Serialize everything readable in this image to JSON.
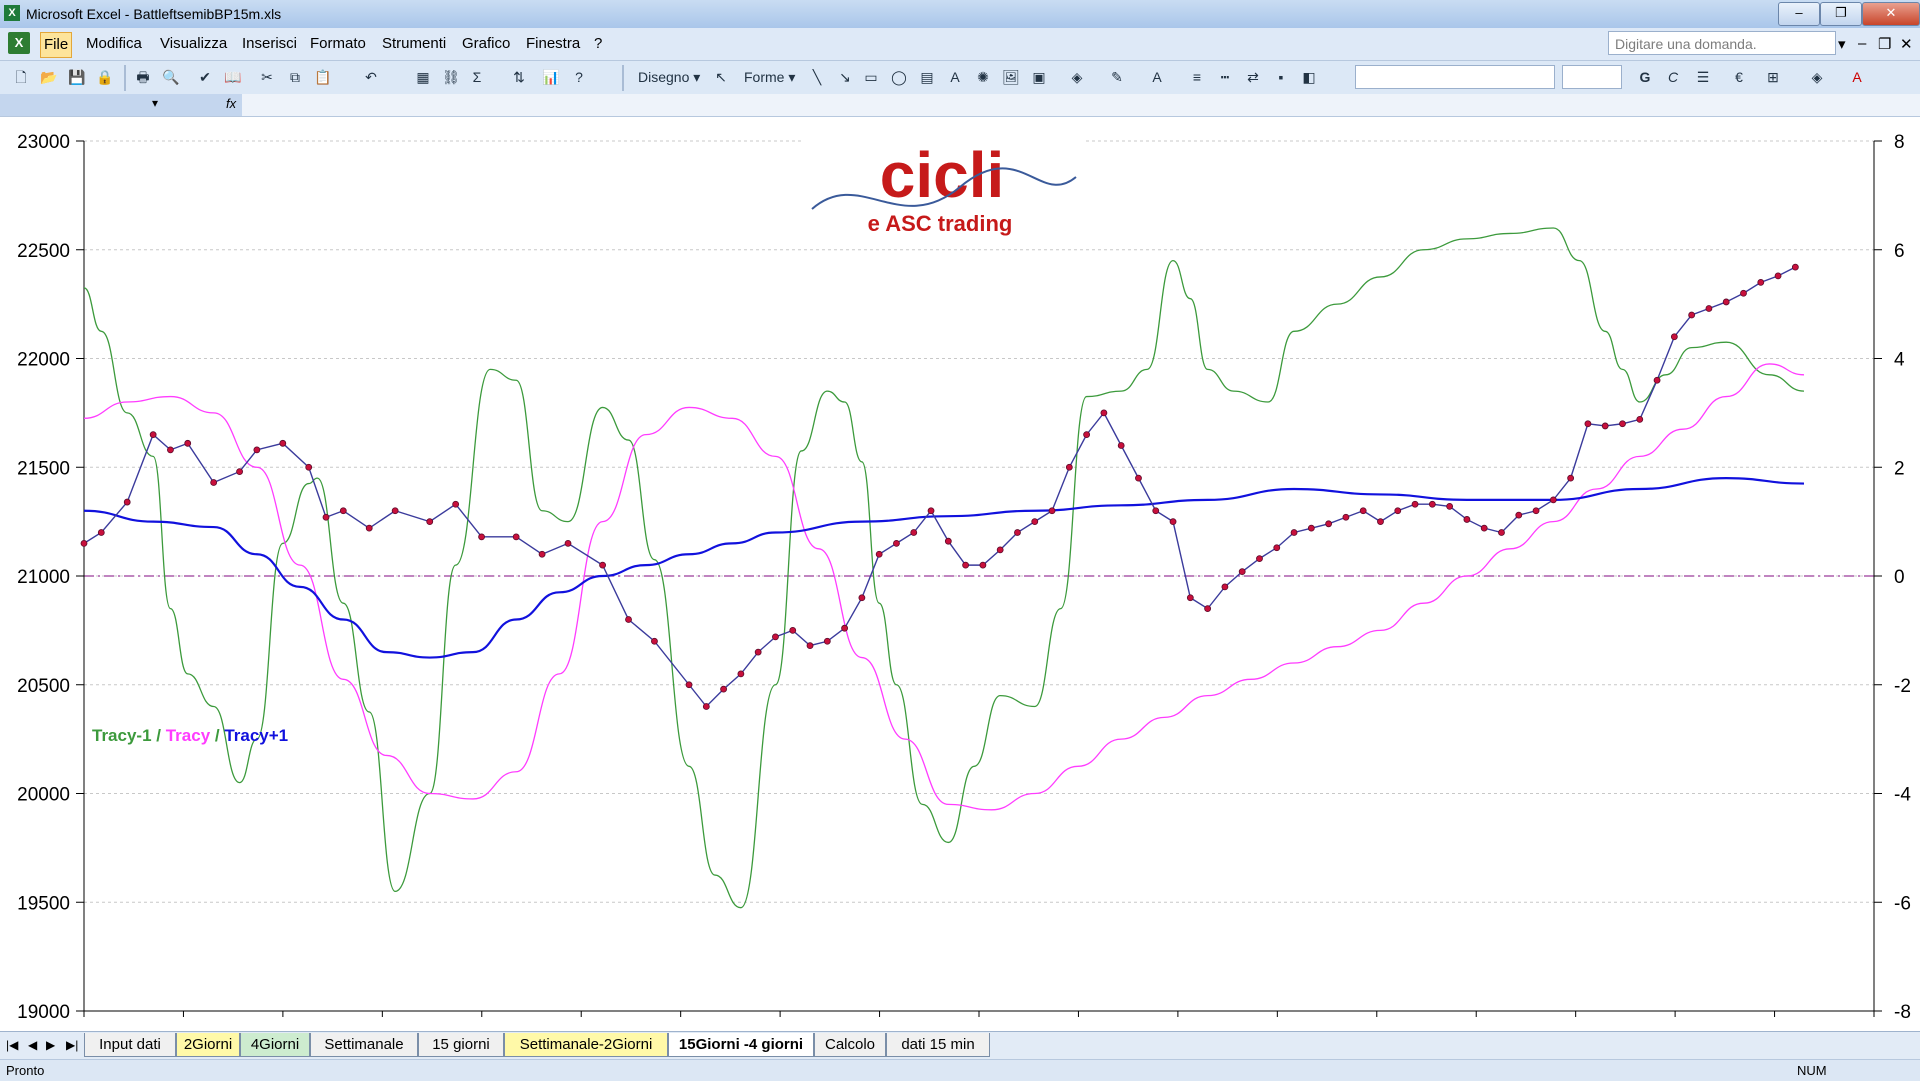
{
  "window": {
    "title": "Microsoft Excel - BattleftsemibBP15m.xls",
    "minimize": "–",
    "restore": "❐",
    "close": "✕"
  },
  "menu": {
    "items": [
      "File",
      "Modifica",
      "Visualizza",
      "Inserisci",
      "Formato",
      "Strumenti",
      "Grafico",
      "Finestra",
      "?"
    ],
    "ask_placeholder": "Digitare una domanda."
  },
  "toolbar": {
    "disegno": "Disegno ▾",
    "forme": "Forme ▾",
    "bold_label": "G",
    "italic_label": "C",
    "euro": "€",
    "fx": "fx"
  },
  "chart_data": {
    "type": "line",
    "ylim_left": [
      19000,
      23000
    ],
    "yticks_left": [
      "23000",
      "22500",
      "22000",
      "21500",
      "21000",
      "20500",
      "20000",
      "19500",
      "19000"
    ],
    "ylim_right": [
      -8,
      8
    ],
    "yticks_right": [
      "8",
      "6",
      "4",
      "2",
      "0",
      "-2",
      "-4",
      "-6",
      "-8"
    ],
    "logo": {
      "line1": "cicli",
      "line2": "e ASC trading"
    },
    "legend": {
      "tracy_minus1": "Tracy-1",
      "sep1": " / ",
      "tracy": "Tracy",
      "sep2": " / ",
      "tracy_plus1": "Tracy+1"
    },
    "colors": {
      "price": "#3b3b9c",
      "marker": "#c8103c",
      "tracy_minus1": "#3c9a3c",
      "tracy": "#ff3cff",
      "tracy_plus1": "#1111dd",
      "zero_line": "#9a3a9a"
    },
    "series": [
      {
        "name": "Tracy-1",
        "axis": "right",
        "x": [
          0,
          2,
          5,
          8,
          10,
          12,
          15,
          18,
          20,
          23,
          26,
          27,
          30,
          33,
          36,
          40,
          43,
          47,
          50,
          53,
          56,
          60,
          63,
          66,
          70,
          73,
          76,
          80,
          83,
          86,
          88,
          90,
          92,
          94,
          97,
          100,
          103,
          106,
          110,
          113,
          116,
          120,
          123,
          126,
          128,
          130,
          133,
          137,
          140,
          145,
          150,
          155,
          160,
          165,
          170,
          173,
          176,
          178,
          180,
          183,
          186,
          190,
          195,
          199
        ],
        "values": [
          5.3,
          4.5,
          3,
          2.2,
          -0.6,
          -1.8,
          -2.4,
          -3.8,
          -3,
          0.6,
          1.7,
          1.8,
          -0.5,
          -2.5,
          -5.8,
          -4,
          0.2,
          3.8,
          3.6,
          1.2,
          1,
          3.1,
          2.5,
          0.3,
          -3.5,
          -5.5,
          -6.1,
          -2,
          2.3,
          3.4,
          3.2,
          2.1,
          -0.5,
          -2,
          -4.2,
          -4.9,
          -3.5,
          -2.2,
          -2.4,
          -0.6,
          3.3,
          3.4,
          3.8,
          5.8,
          5.1,
          3.8,
          3.4,
          3.2,
          4.5,
          5.0,
          5.5,
          6.0,
          6.2,
          6.3,
          6.4,
          5.8,
          4.5,
          3.8,
          3.2,
          3.7,
          4.2,
          4.3,
          3.7,
          3.4
        ]
      },
      {
        "name": "Tracy",
        "axis": "right",
        "x": [
          0,
          5,
          10,
          15,
          20,
          25,
          30,
          35,
          40,
          45,
          50,
          55,
          60,
          65,
          70,
          75,
          80,
          85,
          90,
          95,
          100,
          105,
          110,
          115,
          120,
          125,
          130,
          135,
          140,
          145,
          150,
          155,
          160,
          165,
          170,
          175,
          180,
          185,
          190,
          195,
          199
        ],
        "values": [
          2.9,
          3.2,
          3.3,
          3.0,
          2.0,
          0.2,
          -1.9,
          -3.3,
          -4.0,
          -4.1,
          -3.6,
          -1.8,
          1.0,
          2.6,
          3.1,
          2.9,
          2.2,
          0.5,
          -1.5,
          -3.0,
          -4.2,
          -4.3,
          -4.0,
          -3.5,
          -3.0,
          -2.6,
          -2.2,
          -1.9,
          -1.6,
          -1.3,
          -1.0,
          -0.5,
          0.0,
          0.5,
          1.0,
          1.6,
          2.2,
          2.7,
          3.3,
          3.9,
          3.7
        ]
      },
      {
        "name": "Tracy+1",
        "axis": "right",
        "x": [
          0,
          8,
          15,
          20,
          25,
          30,
          35,
          40,
          45,
          50,
          55,
          60,
          65,
          70,
          75,
          80,
          90,
          100,
          110,
          120,
          130,
          140,
          150,
          160,
          170,
          180,
          190,
          199
        ],
        "values": [
          1.2,
          1.0,
          0.9,
          0.4,
          -0.2,
          -0.8,
          -1.4,
          -1.5,
          -1.4,
          -0.8,
          -0.3,
          0.0,
          0.2,
          0.4,
          0.6,
          0.8,
          1.0,
          1.1,
          1.2,
          1.3,
          1.4,
          1.6,
          1.5,
          1.4,
          1.4,
          1.6,
          1.8,
          1.7
        ]
      }
    ],
    "price": {
      "name": "15m close",
      "axis": "left",
      "x": [
        0,
        2,
        5,
        8,
        10,
        12,
        15,
        18,
        20,
        23,
        26,
        28,
        30,
        33,
        36,
        40,
        43,
        46,
        50,
        53,
        56,
        60,
        63,
        66,
        70,
        72,
        74,
        76,
        78,
        80,
        82,
        84,
        86,
        88,
        90,
        92,
        94,
        96,
        98,
        100,
        102,
        104,
        106,
        108,
        110,
        112,
        114,
        116,
        118,
        120,
        122,
        124,
        126,
        128,
        130,
        132,
        134,
        136,
        138,
        140,
        142,
        144,
        146,
        148,
        150,
        152,
        154,
        156,
        158,
        160,
        162,
        164,
        166,
        168,
        170,
        172,
        174,
        176,
        178,
        180,
        182,
        184,
        186,
        188,
        190,
        192,
        194,
        196,
        198
      ],
      "values": [
        21150,
        21200,
        21340,
        21650,
        21580,
        21610,
        21430,
        21480,
        21580,
        21610,
        21500,
        21270,
        21300,
        21220,
        21300,
        21250,
        21330,
        21180,
        21180,
        21100,
        21150,
        21050,
        20800,
        20700,
        20500,
        20400,
        20480,
        20550,
        20650,
        20720,
        20750,
        20680,
        20700,
        20760,
        20900,
        21100,
        21150,
        21200,
        21300,
        21160,
        21050,
        21050,
        21120,
        21200,
        21250,
        21300,
        21500,
        21650,
        21750,
        21600,
        21450,
        21300,
        21250,
        20900,
        20850,
        20950,
        21020,
        21080,
        21130,
        21200,
        21220,
        21240,
        21270,
        21300,
        21250,
        21300,
        21330,
        21330,
        21320,
        21260,
        21220,
        21200,
        21280,
        21300,
        21350,
        21450,
        21700,
        21690,
        21700,
        21720,
        21900,
        22100,
        22200,
        22230,
        22260,
        22300,
        22350,
        22380,
        22420
      ]
    }
  },
  "sheet_tabs": {
    "nav": [
      "|◀",
      "◀",
      "▶",
      "▶|"
    ],
    "tabs": [
      "Input dati",
      "2Giorni",
      "4Giorni",
      "Settimanale",
      "15 giorni",
      "Settimanale-2Giorni",
      "15Giorni -4 giorni",
      "Calcolo",
      "dati 15 min"
    ]
  },
  "status": {
    "ready": "Pronto",
    "num": "NUM"
  }
}
